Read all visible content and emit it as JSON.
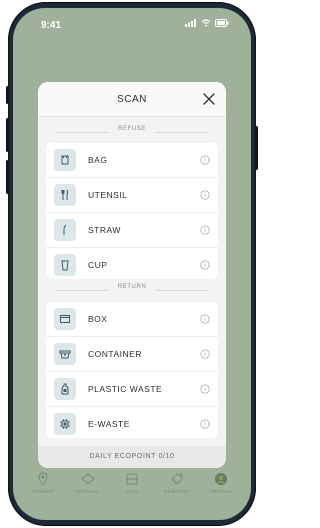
{
  "status": {
    "time": "9:41"
  },
  "modal": {
    "title": "SCAN",
    "sections": {
      "refuse": {
        "label": "REFUSE",
        "items": [
          {
            "label": "BAG",
            "icon": "bag-icon"
          },
          {
            "label": "UTENSIL",
            "icon": "utensil-icon"
          },
          {
            "label": "STRAW",
            "icon": "straw-icon"
          },
          {
            "label": "CUP",
            "icon": "cup-icon"
          }
        ]
      },
      "return": {
        "label": "RETURN",
        "items": [
          {
            "label": "BOX",
            "icon": "box-icon"
          },
          {
            "label": "CONTAINER",
            "icon": "container-icon"
          },
          {
            "label": "PLASTIC WASTE",
            "icon": "bottle-icon"
          },
          {
            "label": "E-WASTE",
            "icon": "chip-icon"
          }
        ]
      }
    },
    "footer": "DAILY ECOPOINT 0/10"
  },
  "bottom_nav": [
    {
      "label": "COMMAP",
      "icon": "map-pin-icon"
    },
    {
      "label": "ECOLAND",
      "icon": "land-icon"
    },
    {
      "label": "SCAN",
      "icon": "scan-icon"
    },
    {
      "label": "REWARDS",
      "icon": "tag-icon"
    },
    {
      "label": "PROFILE",
      "icon": "profile-icon"
    }
  ],
  "colors": {
    "background": "#9fb19b",
    "icon_tile": "#dde7ea",
    "icon_stroke": "#3f5964"
  }
}
